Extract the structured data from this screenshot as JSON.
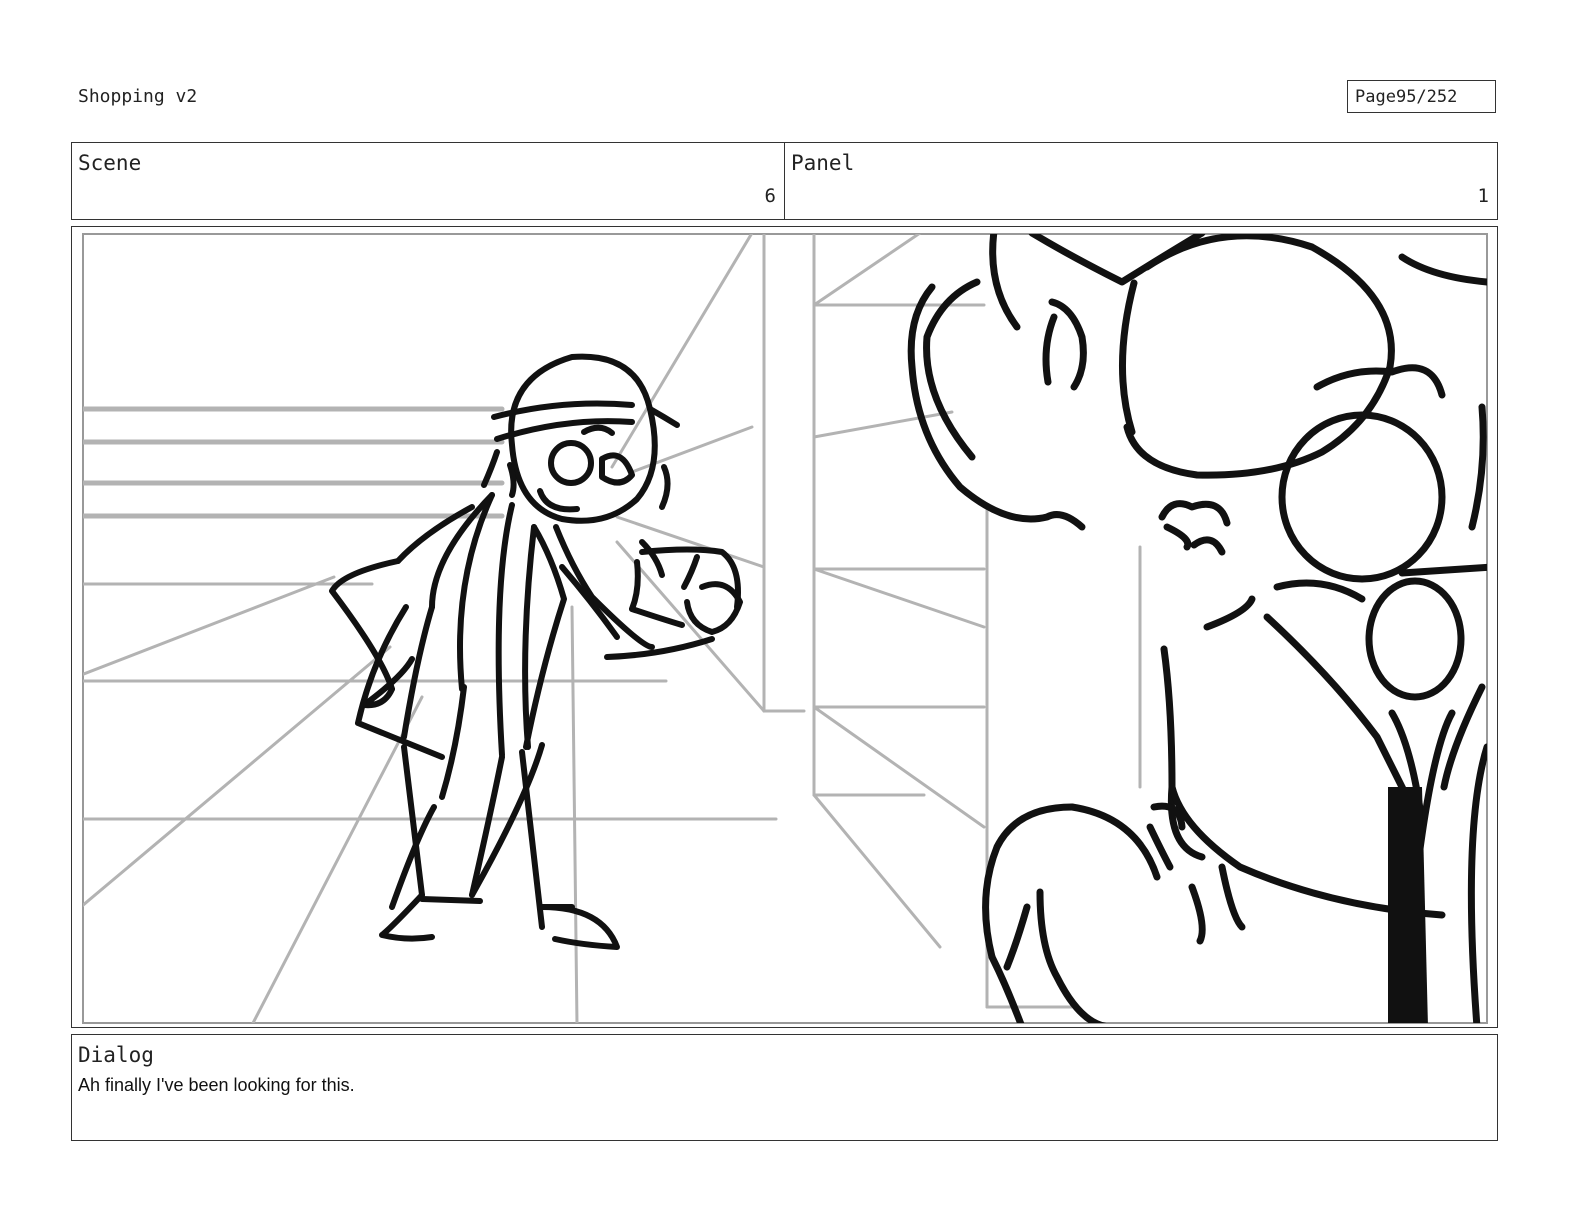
{
  "document": {
    "title": "Shopping v2",
    "page_label": "Page",
    "page_number": "95/252"
  },
  "header": {
    "scene_label": "Scene",
    "scene_value": "6",
    "panel_label": "Panel",
    "panel_value": "1"
  },
  "dialog": {
    "label": "Dialog",
    "text": "Ah finally I've been looking for this."
  }
}
